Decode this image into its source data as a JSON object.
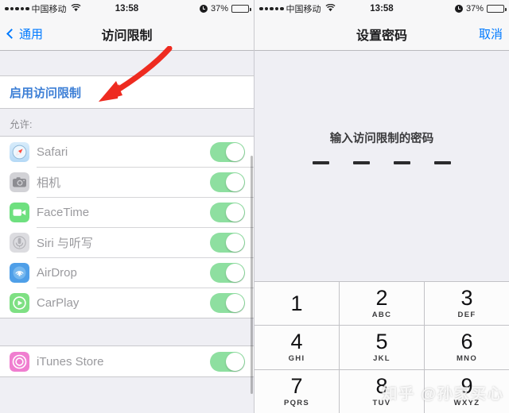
{
  "status_bar": {
    "signal_dots": 5,
    "carrier": "中国移动",
    "wifi_icon": "wifi-icon",
    "time": "13:58",
    "alarm_icon": "alarm-clock-icon",
    "battery_percent": "37%",
    "battery_level": 37
  },
  "left_screen": {
    "nav": {
      "back_label": "通用",
      "back_icon": "chevron-left-icon",
      "title": "访问限制"
    },
    "enable_row": {
      "label": "启用访问限制"
    },
    "section_header": "允许:",
    "apps": [
      {
        "name": "Safari",
        "icon": "safari-icon",
        "enabled": true
      },
      {
        "name": "相机",
        "icon": "camera-icon",
        "enabled": true
      },
      {
        "name": "FaceTime",
        "icon": "facetime-icon",
        "enabled": true
      },
      {
        "name": "Siri 与听写",
        "icon": "siri-icon",
        "enabled": true
      },
      {
        "name": "AirDrop",
        "icon": "airdrop-icon",
        "enabled": true
      },
      {
        "name": "CarPlay",
        "icon": "carplay-icon",
        "enabled": true
      }
    ],
    "partial_app": {
      "name": "iTunes Store",
      "icon": "itunes-store-icon",
      "enabled": true
    },
    "annotation": {
      "type": "red-arrow",
      "color": "#EE2B20",
      "points_to": "启用访问限制"
    }
  },
  "right_screen": {
    "nav": {
      "title": "设置密码",
      "cancel_label": "取消"
    },
    "prompt": "输入访问限制的密码",
    "passcode_length": 4,
    "passcode_entered": 0,
    "keypad": [
      {
        "num": "1",
        "letters": ""
      },
      {
        "num": "2",
        "letters": "ABC"
      },
      {
        "num": "3",
        "letters": "DEF"
      },
      {
        "num": "4",
        "letters": "GHI"
      },
      {
        "num": "5",
        "letters": "JKL"
      },
      {
        "num": "6",
        "letters": "MNO"
      },
      {
        "num": "7",
        "letters": "PQRS"
      },
      {
        "num": "8",
        "letters": "TUV"
      },
      {
        "num": "9",
        "letters": "WXYZ"
      }
    ]
  },
  "watermark": "知乎 @孙家买心",
  "colors": {
    "accent_blue": "#007aff",
    "toggle_green": "#8edfa0",
    "arrow_red": "#EE2B20",
    "group_bg": "#EFEFF4"
  }
}
